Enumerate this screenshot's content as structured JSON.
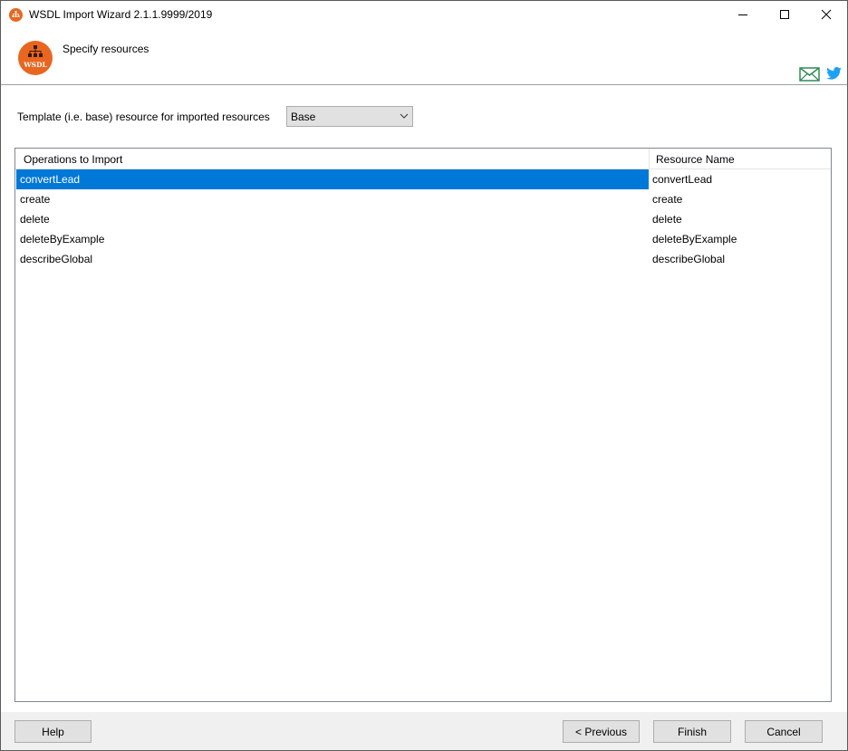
{
  "window": {
    "title": "WSDL Import Wizard 2.1.1.9999/2019",
    "app_icon": "wsdl-logo-icon",
    "controls": [
      "minimize-icon",
      "maximize-icon",
      "close-icon"
    ]
  },
  "header": {
    "logo_text": "WSDL",
    "subtitle": "Specify resources",
    "icons": [
      "mail-icon",
      "twitter-icon"
    ]
  },
  "template": {
    "label": "Template (i.e. base) resource for imported resources",
    "selected": "Base"
  },
  "table": {
    "columns": [
      "Operations to Import",
      "Resource Name"
    ],
    "rows": [
      {
        "operation": "convertLead",
        "resource": "convertLead",
        "selected": true
      },
      {
        "operation": "create",
        "resource": "create",
        "selected": false
      },
      {
        "operation": "delete",
        "resource": "delete",
        "selected": false
      },
      {
        "operation": "deleteByExample",
        "resource": "deleteByExample",
        "selected": false
      },
      {
        "operation": "describeGlobal",
        "resource": "describeGlobal",
        "selected": false
      }
    ]
  },
  "footer": {
    "help": "Help",
    "previous": "< Previous",
    "finish": "Finish",
    "cancel": "Cancel"
  },
  "colors": {
    "accent_orange": "#e8661f",
    "selection_blue": "#0078d7",
    "mail_green": "#2e8b57",
    "twitter_blue": "#1da1f2"
  }
}
